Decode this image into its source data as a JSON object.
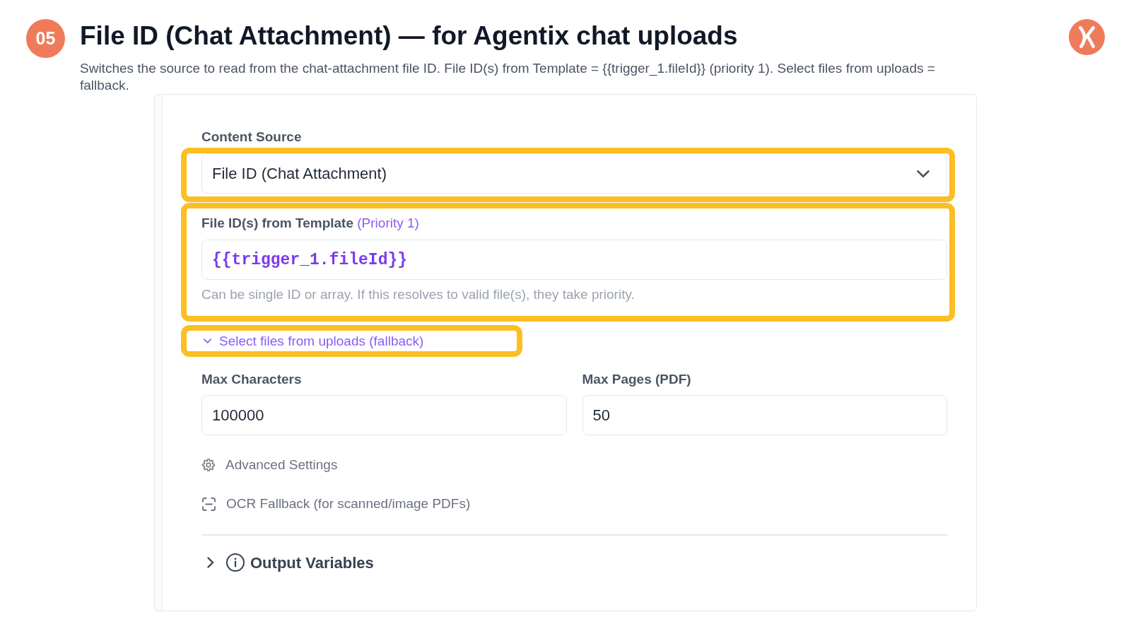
{
  "slide": {
    "step": "05",
    "title": "File ID (Chat Attachment) — for Agentix chat uploads",
    "description": "Switches the source to read from the chat-attachment file ID. File ID(s) from Template = {{trigger_1.fileId}} (priority 1). Select files from uploads = fallback."
  },
  "panel": {
    "content_source": {
      "label": "Content Source",
      "value": "File ID (Chat Attachment)",
      "highlighted": true
    },
    "template_field": {
      "label": "File ID(s) from Template",
      "label_note": "(Priority 1)",
      "value": "{{trigger_1.fileId}}",
      "hint": "Can be single ID or array. If this resolves to valid file(s), they take priority.",
      "highlighted": true
    },
    "fallback_toggle": {
      "label": "Select files from uploads (fallback)",
      "highlighted": true
    },
    "number_fields": [
      {
        "label": "Max Characters",
        "value": "100000"
      },
      {
        "label": "Max Pages (PDF)",
        "value": "50"
      }
    ],
    "options": [
      {
        "kind": "settings",
        "label": "Advanced Settings"
      },
      {
        "kind": "ocr",
        "label": "OCR Fallback (for scanned/image PDFs)"
      }
    ],
    "output_section": {
      "label": "Output Variables"
    }
  }
}
